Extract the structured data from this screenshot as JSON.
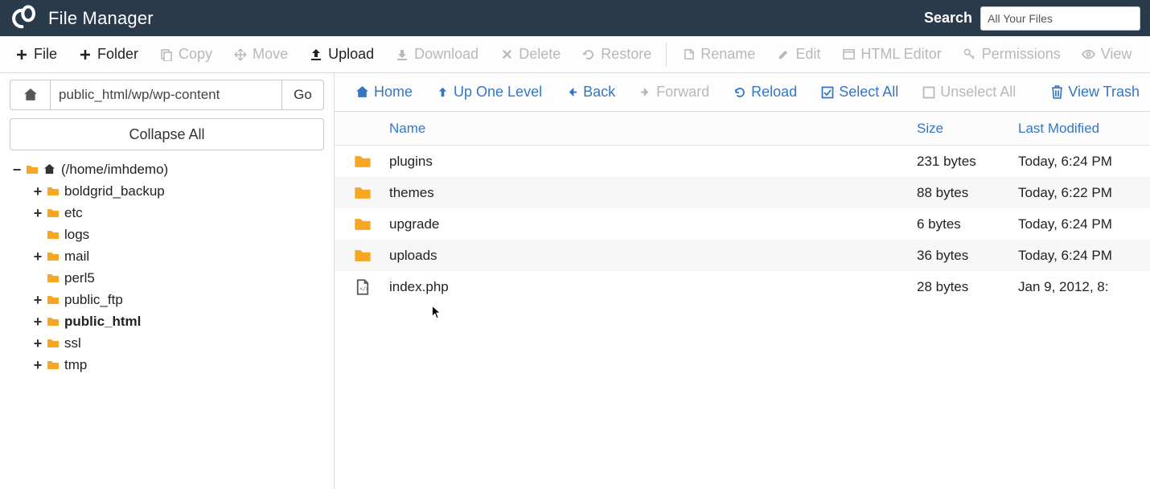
{
  "header": {
    "app_title": "File Manager",
    "search_label": "Search",
    "search_value": "All Your Files"
  },
  "toolbar": {
    "file": "File",
    "folder": "Folder",
    "copy": "Copy",
    "move": "Move",
    "upload": "Upload",
    "download": "Download",
    "delete": "Delete",
    "restore": "Restore",
    "rename": "Rename",
    "edit": "Edit",
    "html_editor": "HTML Editor",
    "permissions": "Permissions",
    "view": "View"
  },
  "sidebar": {
    "path_value": "public_html/wp/wp-content",
    "go": "Go",
    "collapse_all": "Collapse All",
    "root_label": "(/home/imhdemo)",
    "tree": [
      {
        "label": "boldgrid_backup",
        "expandable": true
      },
      {
        "label": "etc",
        "expandable": true
      },
      {
        "label": "logs",
        "expandable": false
      },
      {
        "label": "mail",
        "expandable": true
      },
      {
        "label": "perl5",
        "expandable": false
      },
      {
        "label": "public_ftp",
        "expandable": true
      },
      {
        "label": "public_html",
        "expandable": true,
        "bold": true
      },
      {
        "label": "ssl",
        "expandable": true
      },
      {
        "label": "tmp",
        "expandable": true
      }
    ]
  },
  "actionbar": {
    "home": "Home",
    "up": "Up One Level",
    "back": "Back",
    "forward": "Forward",
    "reload": "Reload",
    "select_all": "Select All",
    "unselect_all": "Unselect All",
    "view_trash": "View Trash"
  },
  "columns": {
    "name": "Name",
    "size": "Size",
    "modified": "Last Modified"
  },
  "files": [
    {
      "type": "folder",
      "name": "plugins",
      "size": "231 bytes",
      "modified": "Today, 6:24 PM"
    },
    {
      "type": "folder",
      "name": "themes",
      "size": "88 bytes",
      "modified": "Today, 6:22 PM"
    },
    {
      "type": "folder",
      "name": "upgrade",
      "size": "6 bytes",
      "modified": "Today, 6:24 PM"
    },
    {
      "type": "folder",
      "name": "uploads",
      "size": "36 bytes",
      "modified": "Today, 6:24 PM"
    },
    {
      "type": "file",
      "name": "index.php",
      "size": "28 bytes",
      "modified": "Jan 9, 2012, 8:"
    }
  ]
}
